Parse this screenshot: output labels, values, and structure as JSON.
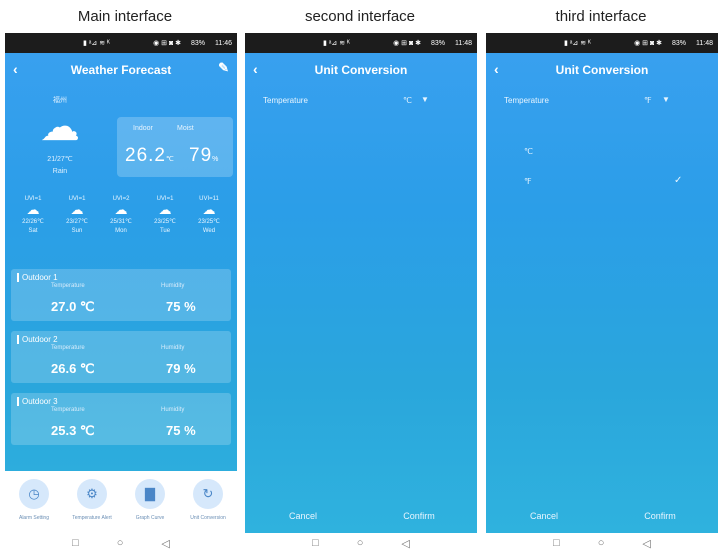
{
  "captions": [
    "Main interface",
    "second interface",
    "third interface"
  ],
  "status": {
    "signal": "▮ ᵃ⊿ ≋ ᴷ",
    "icons": "◉ ⊞ ◙ ✱",
    "battery": "83%",
    "time1": "11:46",
    "time2": "11:48",
    "time3": "11:48"
  },
  "main": {
    "title": "Weather Forecast",
    "back_icon": "chevron-left-icon",
    "edit_icon": "pencil-icon",
    "today": {
      "location": "福州",
      "range": "21/27℃",
      "condition": "Rain"
    },
    "indoor": {
      "label": "Indoor",
      "value": "26.2",
      "unit": "℃"
    },
    "humid": {
      "label": "Moist",
      "value": "79",
      "unit": "%"
    },
    "forecast": [
      {
        "uvi": "UVI=1",
        "range": "22/26℃",
        "day": "Sat"
      },
      {
        "uvi": "UVI=1",
        "range": "23/27℃",
        "day": "Sun"
      },
      {
        "uvi": "UVI=2",
        "range": "25/31℃",
        "day": "Mon"
      },
      {
        "uvi": "UVI=1",
        "range": "23/25℃",
        "day": "Tue"
      },
      {
        "uvi": "UVI=11",
        "range": "23/25℃",
        "day": "Wed"
      }
    ],
    "outdoors": [
      {
        "name": "Outdoor 1",
        "temp_label": "Temperature",
        "temp": "27.0 ℃",
        "hum_label": "Humidity",
        "hum": "75 %"
      },
      {
        "name": "Outdoor 2",
        "temp_label": "Temperature",
        "temp": "26.6 ℃",
        "hum_label": "Humidity",
        "hum": "79 %"
      },
      {
        "name": "Outdoor 3",
        "temp_label": "Temperature",
        "temp": "25.3 ℃",
        "hum_label": "Humidity",
        "hum": "75 %"
      }
    ],
    "bottom": [
      {
        "label": "Alarm Setting",
        "icon": "clock-icon"
      },
      {
        "label": "Temperature Alert",
        "icon": "gear-icon"
      },
      {
        "label": "Graph Curve",
        "icon": "chart-icon"
      },
      {
        "label": "Unit Conversion",
        "icon": "refresh-icon"
      }
    ]
  },
  "unit": {
    "title": "Unit Conversion",
    "row_label": "Temperature",
    "value_c": "℃",
    "value_f": "℉",
    "option_c": "℃",
    "option_f": "℉",
    "cancel": "Cancel",
    "confirm": "Confirm"
  },
  "nav": {
    "square": "□",
    "circle": "○",
    "back": "◁"
  },
  "colors": {
    "accent": "#2b9ee8",
    "background": "#ffffff"
  }
}
